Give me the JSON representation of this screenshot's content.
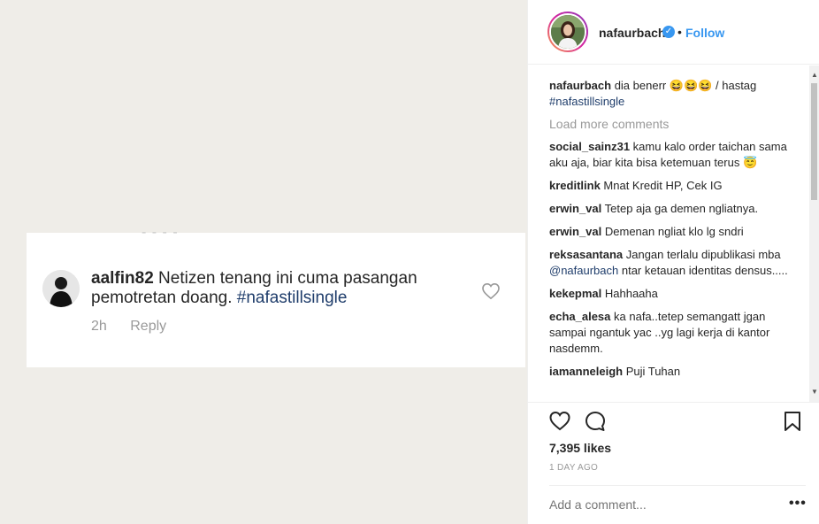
{
  "comment_card": {
    "username": "aalfin82",
    "text": "Netizen tenang ini cuma pasangan pemotretan doang. ",
    "hashtag": "#nafastillsingle",
    "time": "2h",
    "reply_label": "Reply"
  },
  "post": {
    "author": "nafaurbach",
    "separator": "•",
    "follow_label": "Follow",
    "caption_user": "nafaurbach",
    "caption_text": " dia benerr 😆😆😆 / hastag ",
    "caption_hashtag": "#nafastillsingle",
    "load_more_label": "Load more comments",
    "comments": [
      {
        "user": "social_sainz31",
        "text": " kamu kalo order taichan sama aku aja, biar kita bisa ketemuan terus 😇"
      },
      {
        "user": "kreditlink",
        "text": " Mnat Kredit HP, Cek IG"
      },
      {
        "user": "erwin_val",
        "text": " Tetep aja ga demen ngliatnya."
      },
      {
        "user": "erwin_val",
        "text": " Demenan ngliat klo lg sndri"
      },
      {
        "user": "reksasantana",
        "text": " Jangan terlalu dipublikasi mba ",
        "mention": "@nafaurbach",
        "text2": " ntar ketauan identitas densus....."
      },
      {
        "user": "kekepmal",
        "text": " Hahhaaha"
      },
      {
        "user": "echa_alesa",
        "text": " ka nafa..tetep semangatt jgan sampai ngantuk yac ..yg lagi kerja di kantor nasdemm."
      },
      {
        "user": "iamanneleigh",
        "text": " Puji Tuhan"
      }
    ],
    "likes": "7,395 likes",
    "time_ago": "1 DAY AGO",
    "add_comment_placeholder": "Add a comment...",
    "more_label": "•••"
  },
  "icons": {
    "verified": "verified-badge-icon",
    "heart": "heart-icon",
    "comment": "comment-bubble-icon",
    "save": "bookmark-icon"
  },
  "colors": {
    "link": "#3897f0",
    "hashtag": "#1f3d6b",
    "muted": "#999999",
    "text": "#262626"
  }
}
